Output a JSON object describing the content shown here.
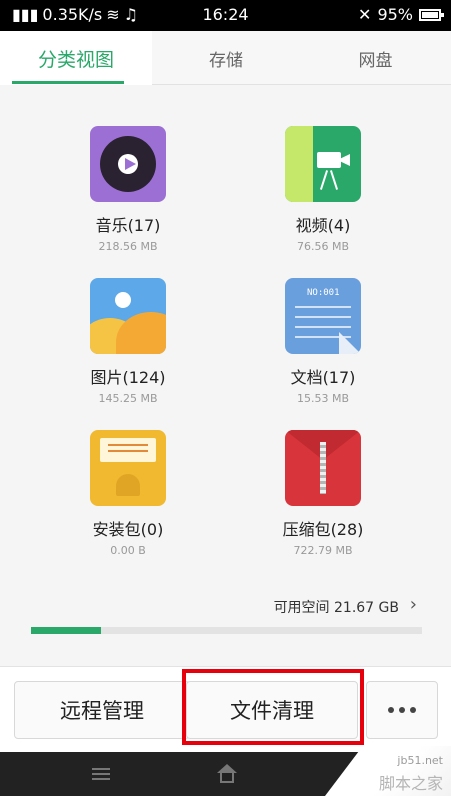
{
  "status_bar": {
    "network_speed": "0.35K/s",
    "time": "16:24",
    "battery_percent": "95%"
  },
  "tabs": [
    {
      "label": "分类视图",
      "active": true
    },
    {
      "label": "存储",
      "active": false
    },
    {
      "label": "网盘",
      "active": false
    }
  ],
  "categories": [
    {
      "name": "音乐(17)",
      "size": "218.56 MB",
      "icon": "music-disc-icon"
    },
    {
      "name": "视频(4)",
      "size": "76.56 MB",
      "icon": "video-camera-icon"
    },
    {
      "name": "图片(124)",
      "size": "145.25 MB",
      "icon": "picture-icon"
    },
    {
      "name": "文档(17)",
      "size": "15.53 MB",
      "icon": "document-icon",
      "icon_text": "NO:001"
    },
    {
      "name": "安装包(0)",
      "size": "0.00 B",
      "icon": "android-package-icon"
    },
    {
      "name": "压缩包(28)",
      "size": "722.79 MB",
      "icon": "zip-archive-icon"
    }
  ],
  "storage": {
    "label": "可用空间 21.67 GB",
    "used_fraction": 0.18
  },
  "actions": {
    "remote": "远程管理",
    "clean": "文件清理"
  },
  "watermark": {
    "site": "jb51.net",
    "brand": "脚本之家"
  },
  "colors": {
    "accent": "#2aa86a",
    "highlight": "#e5000c"
  }
}
